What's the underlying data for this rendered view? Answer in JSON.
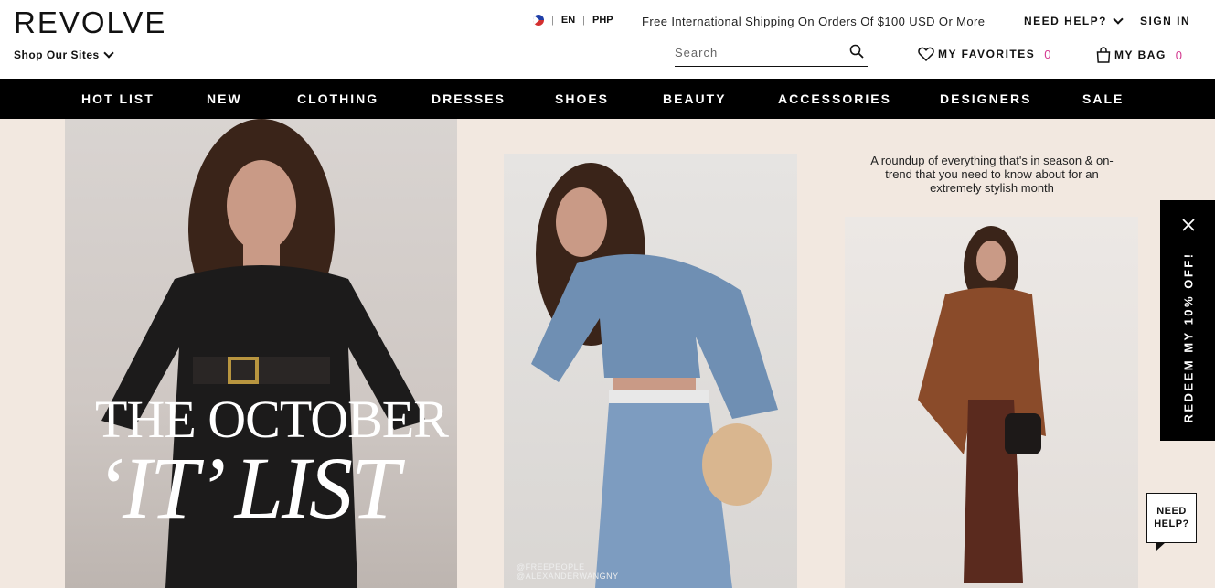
{
  "header": {
    "logo": "REVOLVE",
    "shop_sites": "Shop Our Sites",
    "language": "EN",
    "currency": "PHP",
    "divider": "|",
    "shipping_notice": "Free International Shipping On Orders Of $100 USD Or More",
    "need_help": "NEED HELP?",
    "sign_in": "SIGN IN",
    "search_placeholder": "Search",
    "favorites_label": "MY FAVORITES",
    "favorites_count": "0",
    "bag_label": "MY BAG",
    "bag_count": "0",
    "accent_color": "#d3398f"
  },
  "nav": {
    "items": [
      "HOT LIST",
      "NEW",
      "CLOTHING",
      "DRESSES",
      "SHOES",
      "BEAUTY",
      "ACCESSORIES",
      "DESIGNERS",
      "SALE"
    ]
  },
  "hero": {
    "headline_line1": "THE OCTOBER",
    "headline_line2": "‘IT’ LIST",
    "roundup_text": "A roundup of everything that's in season & on-trend that you need to know about for an extremely stylish month",
    "credit_line1": "@FREEPEOPLE",
    "credit_line2": "@ALEXANDERWANGNY"
  },
  "promo": {
    "label": "REDEEM MY 10% OFF!"
  },
  "help_bubble": {
    "line1": "NEED",
    "line2": "HELP?"
  }
}
